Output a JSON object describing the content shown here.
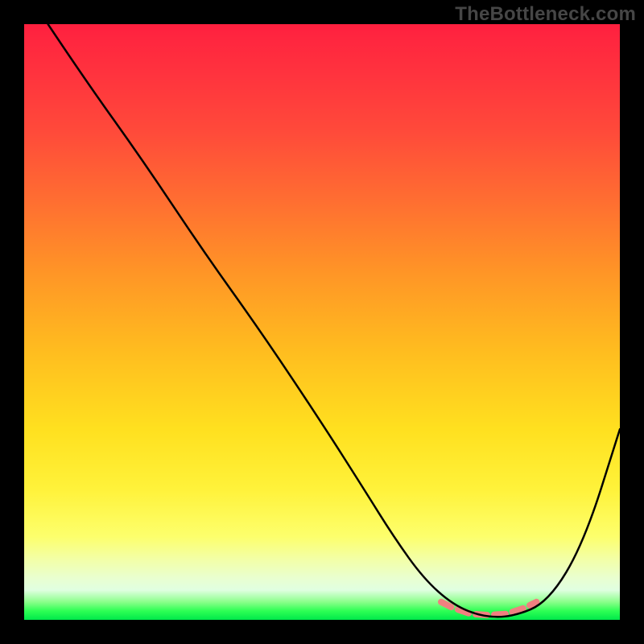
{
  "watermark": "TheBottleneck.com",
  "chart_data": {
    "type": "line",
    "title": "",
    "xlabel": "",
    "ylabel": "",
    "xlim": [
      0,
      100
    ],
    "ylim": [
      0,
      100
    ],
    "grid": false,
    "legend": false,
    "series": [
      {
        "name": "bottleneck-curve",
        "x": [
          4,
          10,
          20,
          30,
          40,
          50,
          57,
          62,
          67,
          72,
          77,
          82,
          88,
          94,
          100
        ],
        "y": [
          100,
          91,
          77,
          62,
          48,
          33,
          22,
          14,
          7,
          2.5,
          0.5,
          0.5,
          3,
          13,
          32
        ],
        "color": "#000000",
        "stroke_width": 2.5
      },
      {
        "name": "optimum-marker",
        "x": [
          70,
          72,
          75,
          78,
          81,
          84,
          86
        ],
        "y": [
          3,
          2,
          1,
          0.8,
          1,
          2,
          3
        ],
        "color": "#f08080",
        "stroke_width": 8,
        "dash": "14 9"
      }
    ],
    "gradient": {
      "direction": "vertical",
      "stops": [
        {
          "pos": 0.0,
          "color": "#ff1f3f"
        },
        {
          "pos": 0.3,
          "color": "#ff6f31"
        },
        {
          "pos": 0.55,
          "color": "#ffbd1f"
        },
        {
          "pos": 0.78,
          "color": "#fff23a"
        },
        {
          "pos": 0.93,
          "color": "#e9ffd0"
        },
        {
          "pos": 1.0,
          "color": "#00e84b"
        }
      ]
    },
    "optimum_range_x": [
      70,
      86
    ]
  }
}
